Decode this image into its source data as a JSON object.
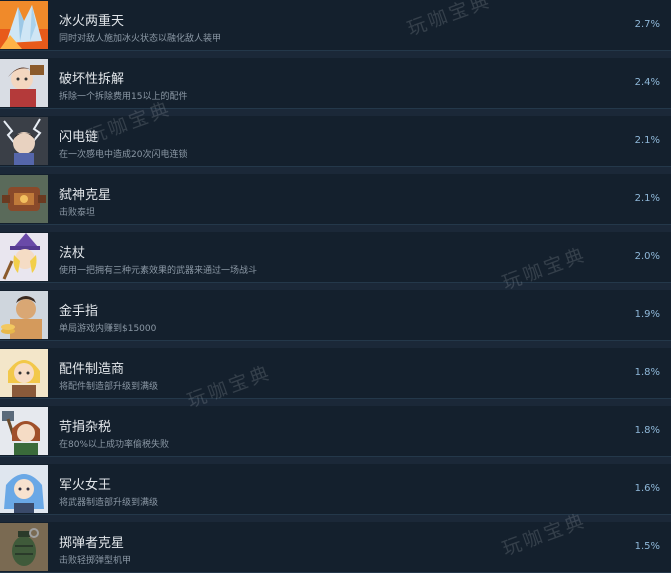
{
  "achievements": [
    {
      "title": "冰火两重天",
      "desc": "同时对敌人施加冰火状态以融化敌人装甲",
      "pct": "2.7%",
      "icon": "ice-crystal-icon"
    },
    {
      "title": "破坏性拆解",
      "desc": "拆除一个拆除费用15以上的配件",
      "pct": "2.4%",
      "icon": "engineer-girl-icon"
    },
    {
      "title": "闪电链",
      "desc": "在一次感电中造成20次闪电连锁",
      "pct": "2.1%",
      "icon": "lightning-girl-icon"
    },
    {
      "title": "弑神克星",
      "desc": "击败泰坦",
      "pct": "2.1%",
      "icon": "titan-machine-icon"
    },
    {
      "title": "法杖",
      "desc": "使用一把拥有三种元素效果的武器来通过一场战斗",
      "pct": "2.0%",
      "icon": "witch-staff-icon"
    },
    {
      "title": "金手指",
      "desc": "单局游戏内赚到$15000",
      "pct": "1.9%",
      "icon": "gold-coins-icon"
    },
    {
      "title": "配件制造商",
      "desc": "将配件制造部升级到满级",
      "pct": "1.8%",
      "icon": "blonde-engineer-icon"
    },
    {
      "title": "苛捐杂税",
      "desc": "在80%以上成功率偷税失败",
      "pct": "1.8%",
      "icon": "tax-axe-girl-icon"
    },
    {
      "title": "军火女王",
      "desc": "将武器制造部升级到满级",
      "pct": "1.6%",
      "icon": "blue-hair-queen-icon"
    },
    {
      "title": "掷弹者克星",
      "desc": "击败轻掷弹型机甲",
      "pct": "1.5%",
      "icon": "grenade-icon"
    }
  ],
  "watermark": "玩咖宝典"
}
